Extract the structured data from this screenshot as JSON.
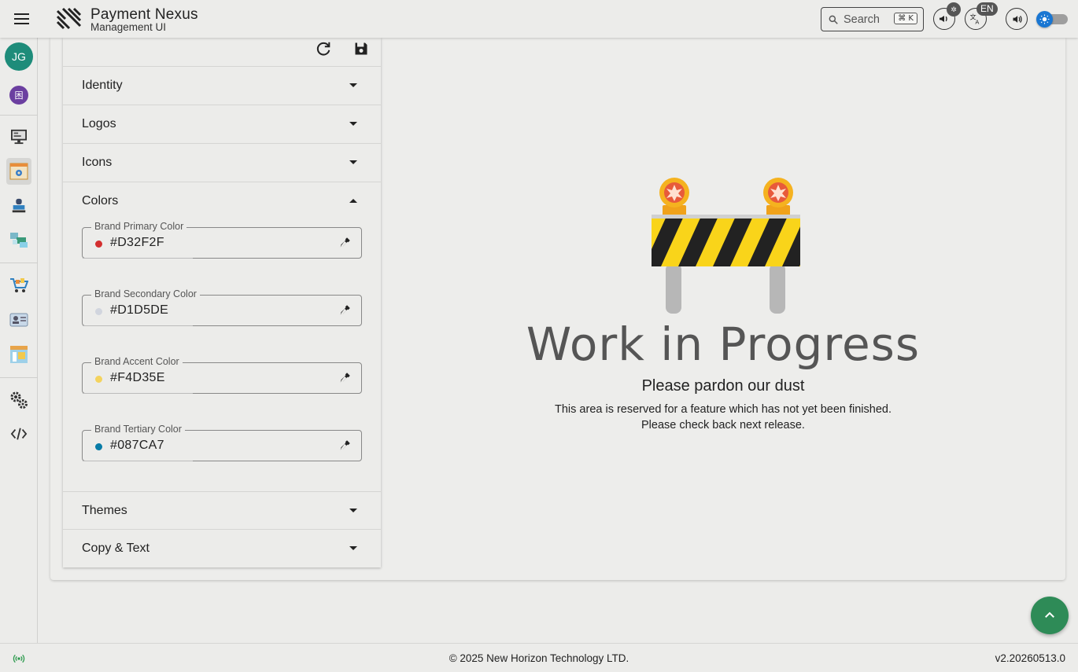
{
  "app": {
    "title": "Payment Nexus",
    "subtitle": "Management UI",
    "user_initials": "JG",
    "org_initial": "困"
  },
  "header": {
    "search_label": "Search",
    "search_shortcut": "⌘ K",
    "notifications_badge": "0",
    "language": "EN"
  },
  "panel": {
    "sections": {
      "identity": "Identity",
      "logos": "Logos",
      "icons": "Icons",
      "colors": "Colors",
      "themes": "Themes",
      "copy_text": "Copy & Text"
    },
    "color_fields": [
      {
        "label": "Brand Primary Color",
        "value": "#D32F2F"
      },
      {
        "label": "Brand Secondary Color",
        "value": "#D1D5DE"
      },
      {
        "label": "Brand Accent Color",
        "value": "#F4D35E"
      },
      {
        "label": "Brand Tertiary Color",
        "value": "#087CA7"
      }
    ]
  },
  "wip": {
    "title": "Work in Progress",
    "subtitle": "Please pardon our dust",
    "line1": "This area is reserved for a feature which has not yet been finished.",
    "line2": "Please check back next release."
  },
  "footer": {
    "copyright": "© 2025 New Horizon Technology LTD.",
    "version": "v2.20260513.0"
  },
  "colors": {
    "accent": "#1976d2",
    "avatar": "#1e8c7a",
    "fab": "#2e8b57"
  }
}
